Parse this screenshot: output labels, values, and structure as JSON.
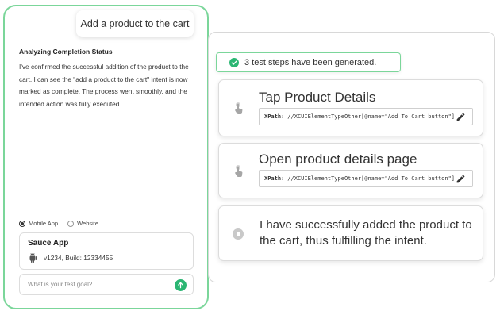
{
  "chat": {
    "user_message": "Add a product to the cart",
    "status_title": "Analyzing Completion Status",
    "status_body": "I've confirmed the successful addition of the product to the cart. I can see the \"add a product to the cart\" intent is now marked as complete. The process went smoothly, and the intended action was fully executed.",
    "radio_options": [
      {
        "label": "Mobile App",
        "checked": true
      },
      {
        "label": "Website",
        "checked": false
      }
    ],
    "app": {
      "name": "Sauce App",
      "build": "v1234, Build: 12334455",
      "platform_icon": "android-icon"
    },
    "goal_placeholder": "What is your test goal?",
    "send_icon": "arrow-up-icon"
  },
  "tests": {
    "generated_text": "3 test steps have been generated.",
    "steps": [
      {
        "title": "Tap Product Details",
        "xpath_label": "XPath:",
        "xpath_value": "//XCUIElementTypeOther[@name=\"Add To Cart button\"]",
        "icon": "tap-icon"
      },
      {
        "title": "Open product details page",
        "xpath_label": "XPath:",
        "xpath_value": "//XCUIElementTypeOther[@name=\"Add To Cart button\"]",
        "icon": "tap-icon"
      },
      {
        "text": "I have successfully added the product to the cart, thus fulfilling the intent.",
        "icon": "stop-icon"
      }
    ]
  },
  "colors": {
    "accent": "#2bb673",
    "panel_border": "#7bd69a"
  }
}
